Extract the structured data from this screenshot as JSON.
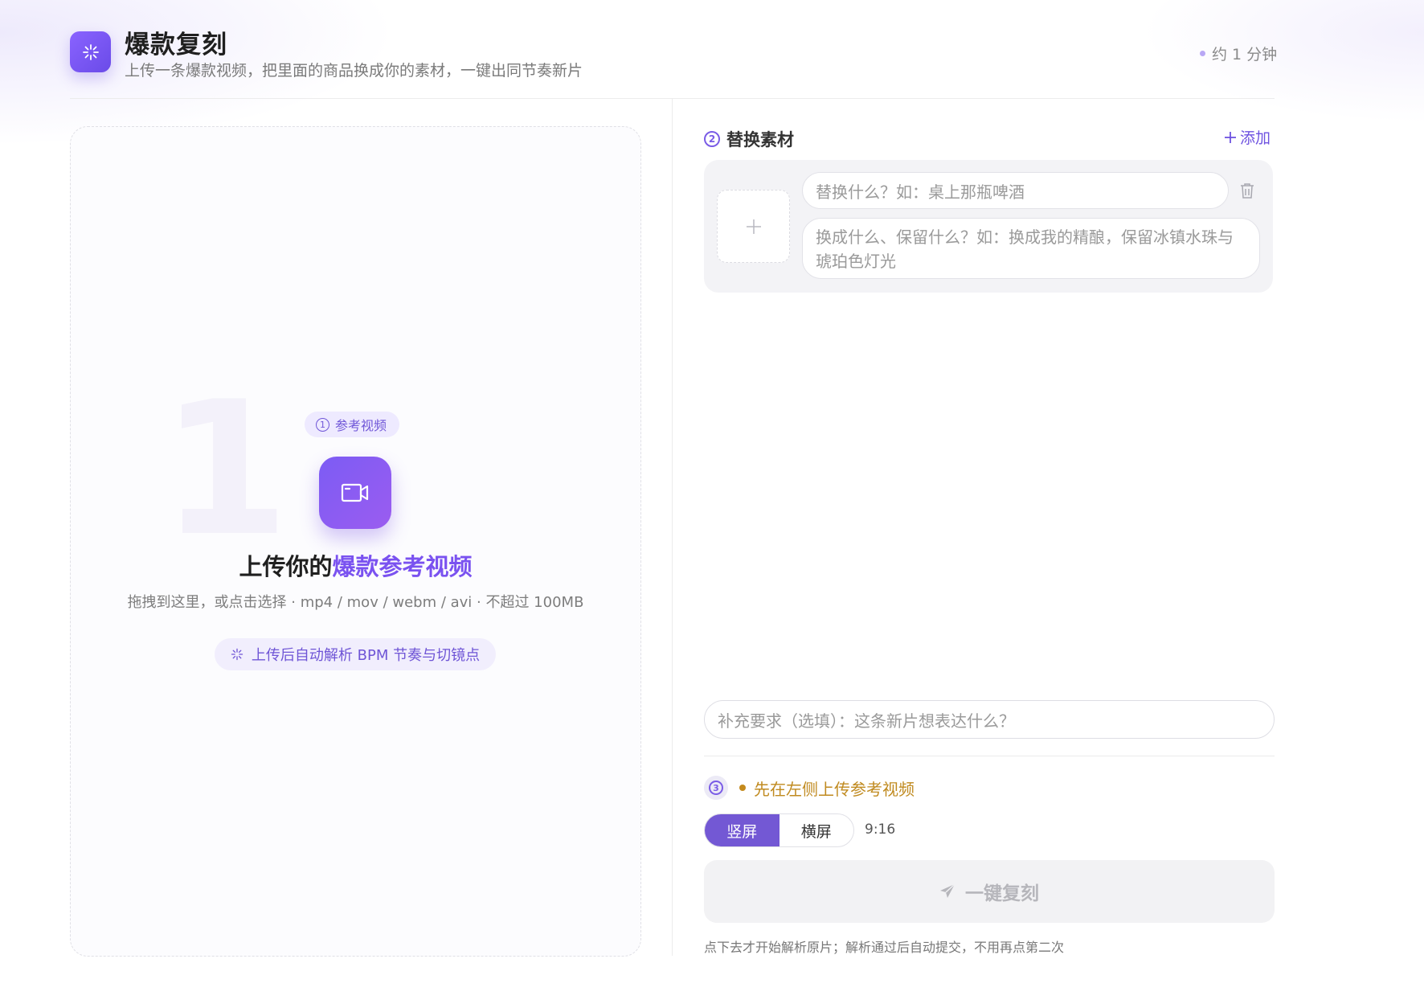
{
  "header": {
    "title": "爆款复刻",
    "subtitle": "上传一条爆款视频，把里面的商品换成你的素材，一键出同节奏新片",
    "time_estimate": "约 1 分钟",
    "icon": "sparkle-icon"
  },
  "upload": {
    "step_watermark": "1",
    "step_number": "1",
    "step_label": "参考视频",
    "title_prefix": "上传你的",
    "title_highlight": "爆款参考视频",
    "hint": "拖拽到这里，或点击选择 · mp4 / mov / webm / avi · 不超过 100MB",
    "bpm_note": "上传后自动解析 BPM 节奏与切镜点",
    "icon": "video-camera-icon"
  },
  "materials": {
    "step_number": "2",
    "title": "替换素材",
    "add_label": "添加",
    "items": [
      {
        "what_placeholder": "替换什么？如：桌上那瓶啤酒",
        "how_placeholder": "换成什么、保留什么？如：换成我的精酿，保留冰镇水珠与琥珀色灯光"
      }
    ]
  },
  "extra": {
    "placeholder": "补充要求（选填）：这条新片想表达什么？"
  },
  "status": {
    "step_number": "3",
    "text": "先在左侧上传参考视频"
  },
  "orientation": {
    "options": [
      "竖屏",
      "横屏"
    ],
    "selected": "竖屏",
    "ratio": "9:16"
  },
  "submit": {
    "label": "一键复刻",
    "footnote": "点下去才开始解析原片；解析通过后自动提交，不用再点第二次"
  },
  "colors": {
    "accent": "#7a52f0",
    "status_warning": "#c08a1f"
  }
}
